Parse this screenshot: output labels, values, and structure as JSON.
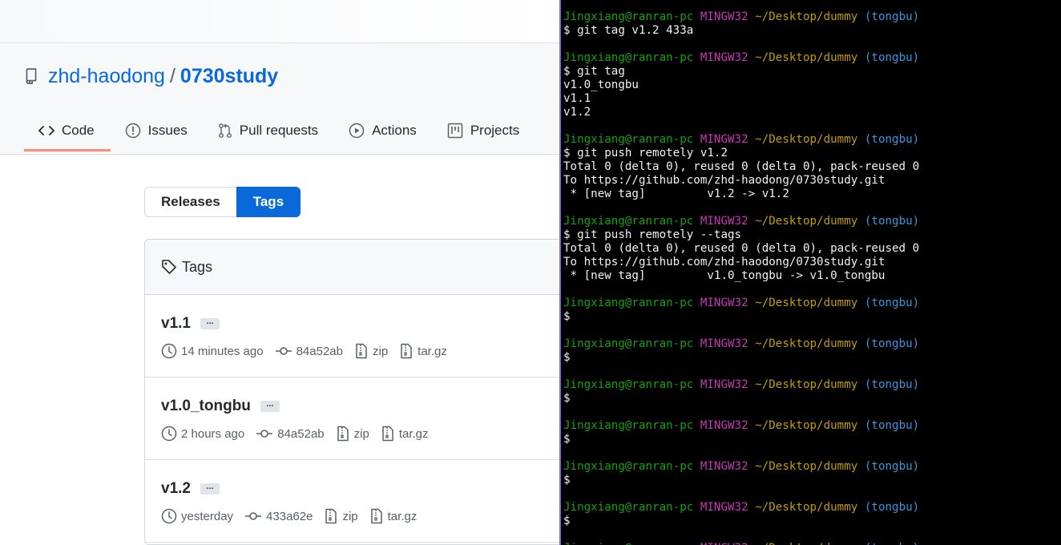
{
  "repo": {
    "owner": "zhd-haodong",
    "separator": "/",
    "name": "0730study"
  },
  "tabs": [
    {
      "label": "Code",
      "icon": "code-icon",
      "selected": true
    },
    {
      "label": "Issues",
      "icon": "issue-opened-icon"
    },
    {
      "label": "Pull requests",
      "icon": "git-pull-request-icon"
    },
    {
      "label": "Actions",
      "icon": "play-icon"
    },
    {
      "label": "Projects",
      "icon": "project-icon"
    }
  ],
  "segmented": {
    "releases": "Releases",
    "tags": "Tags",
    "selected": "Tags"
  },
  "tags_box": {
    "header": "Tags",
    "rows": [
      {
        "name": "v1.1",
        "ellipsis": "...",
        "time": "14 minutes ago",
        "commit": "84a52ab",
        "zip": "zip",
        "targz": "tar.gz"
      },
      {
        "name": "v1.0_tongbu",
        "ellipsis": "...",
        "time": "2 hours ago",
        "commit": "84a52ab",
        "zip": "zip",
        "targz": "tar.gz"
      },
      {
        "name": "v1.2",
        "ellipsis": "...",
        "time": "yesterday",
        "commit": "433a62e",
        "zip": "zip",
        "targz": "tar.gz"
      }
    ]
  },
  "terminal": {
    "prompt": {
      "user": "Jingxiang@ranran-pc",
      "system": "MINGW32",
      "path": "~/Desktop/dummy",
      "branch": "(tongbu)"
    },
    "lines": [
      {
        "kind": "prompt"
      },
      {
        "kind": "text",
        "text": "$ git tag v1.2 433a"
      },
      {
        "kind": "blank"
      },
      {
        "kind": "prompt"
      },
      {
        "kind": "text",
        "text": "$ git tag"
      },
      {
        "kind": "text",
        "text": "v1.0_tongbu"
      },
      {
        "kind": "text",
        "text": "v1.1"
      },
      {
        "kind": "text",
        "text": "v1.2"
      },
      {
        "kind": "blank"
      },
      {
        "kind": "prompt"
      },
      {
        "kind": "text",
        "text": "$ git push remotely v1.2"
      },
      {
        "kind": "text",
        "text": "Total 0 (delta 0), reused 0 (delta 0), pack-reused 0"
      },
      {
        "kind": "text",
        "text": "To https://github.com/zhd-haodong/0730study.git"
      },
      {
        "kind": "text",
        "text": " * [new tag]         v1.2 -> v1.2"
      },
      {
        "kind": "blank"
      },
      {
        "kind": "prompt"
      },
      {
        "kind": "text",
        "text": "$ git push remotely --tags"
      },
      {
        "kind": "text",
        "text": "Total 0 (delta 0), reused 0 (delta 0), pack-reused 0"
      },
      {
        "kind": "text",
        "text": "To https://github.com/zhd-haodong/0730study.git"
      },
      {
        "kind": "text",
        "text": " * [new tag]         v1.0_tongbu -> v1.0_tongbu"
      },
      {
        "kind": "blank"
      },
      {
        "kind": "prompt"
      },
      {
        "kind": "text",
        "text": "$"
      },
      {
        "kind": "blank"
      },
      {
        "kind": "prompt"
      },
      {
        "kind": "text",
        "text": "$"
      },
      {
        "kind": "blank"
      },
      {
        "kind": "prompt"
      },
      {
        "kind": "text",
        "text": "$"
      },
      {
        "kind": "blank"
      },
      {
        "kind": "prompt"
      },
      {
        "kind": "text",
        "text": "$"
      },
      {
        "kind": "blank"
      },
      {
        "kind": "prompt"
      },
      {
        "kind": "text",
        "text": "$"
      },
      {
        "kind": "blank"
      },
      {
        "kind": "prompt"
      },
      {
        "kind": "text",
        "text": "$"
      },
      {
        "kind": "blank"
      },
      {
        "kind": "prompt"
      }
    ]
  },
  "colors": {
    "link_blue": "#0969da",
    "tab_underline": "#fd8c73",
    "term_user": "#13a10e",
    "term_system": "#c239b3",
    "term_path": "#c19c00",
    "term_branch": "#3a96dd"
  }
}
